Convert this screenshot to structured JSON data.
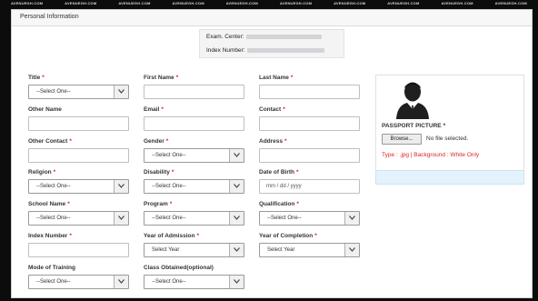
{
  "watermark": {
    "texts": [
      "AVENUEGH.COM",
      "AVENUEGH.COM",
      "AVENUEGH.COM",
      "AVENUEGH.COM",
      "AVENUEGH.COM",
      "AVENUEGH.COM",
      "AVENUEGH.COM",
      "AVENUEGH.COM",
      "AVENUEGH.COM",
      "AVENUEGH.COM"
    ]
  },
  "panel": {
    "title": "Personal Information"
  },
  "exam": {
    "center_label": "Exam. Center:",
    "index_label": "Index Number:"
  },
  "form": {
    "title": {
      "label": "Title",
      "required": "*",
      "value": "--Select One--"
    },
    "first_name": {
      "label": "First Name",
      "required": "*"
    },
    "last_name": {
      "label": "Last Name",
      "required": "*"
    },
    "other_name": {
      "label": "Other Name"
    },
    "email": {
      "label": "Email",
      "required": "*"
    },
    "contact": {
      "label": "Contact",
      "required": "*"
    },
    "other_contact": {
      "label": "Other Contact",
      "required": "*"
    },
    "gender": {
      "label": "Gender",
      "required": "*",
      "value": "--Select One--"
    },
    "address": {
      "label": "Address",
      "required": "*"
    },
    "religion": {
      "label": "Religion",
      "required": "*",
      "value": "--Select One--"
    },
    "disability": {
      "label": "Disability",
      "required": "*",
      "value": "--Select One--"
    },
    "dob": {
      "label": "Date of Birth",
      "required": "*",
      "placeholder": "mm / dd / yyyy"
    },
    "school_name": {
      "label": "School Name",
      "required": "*",
      "value": "--Select One--"
    },
    "program": {
      "label": "Program",
      "required": "*",
      "value": "--Select One--"
    },
    "qualification": {
      "label": "Qualification",
      "required": "*",
      "value": "--Select One--"
    },
    "index_number": {
      "label": "Index Number",
      "required": "*"
    },
    "year_admission": {
      "label": "Year of Admission",
      "required": "*",
      "value": "Select Year"
    },
    "year_completion": {
      "label": "Year of Completion",
      "required": "*",
      "value": "Select Year"
    },
    "mode_training": {
      "label": "Mode of Training",
      "value": "--Select One--"
    },
    "class_obtained": {
      "label": "Class Obtained(optional)",
      "value": "--Select One--"
    }
  },
  "passport": {
    "label": "PASSPORT PICTURE",
    "required": "*",
    "browse_label": "Browse...",
    "no_file": "No file selected.",
    "type_note": "Type : .jpg | Background : White Only"
  },
  "colors": {
    "required": "#d9262a",
    "info_bar": "#e3f2fb"
  }
}
